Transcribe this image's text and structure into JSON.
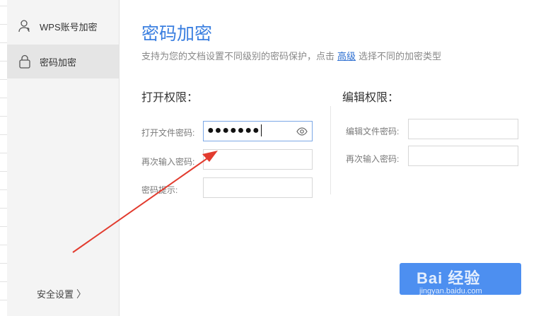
{
  "sidebar": {
    "items": [
      {
        "label": "WPS账号加密",
        "icon": "user-icon",
        "active": false
      },
      {
        "label": "密码加密",
        "icon": "lock-icon",
        "active": true
      }
    ],
    "security_settings": "安全设置"
  },
  "main": {
    "title": "密码加密",
    "description_prefix": "支持为您的文档设置不同级别的密码保护，点击",
    "description_link": "高级",
    "description_suffix": "选择不同的加密类型",
    "open_permission": {
      "section_title": "打开权限：",
      "password_label": "打开文件密码:",
      "password_value": "●●●●●●●",
      "confirm_label": "再次输入密码:",
      "confirm_value": "",
      "hint_label": "密码提示:",
      "hint_value": ""
    },
    "edit_permission": {
      "section_title": "编辑权限：",
      "password_label": "编辑文件密码:",
      "password_value": "",
      "confirm_label": "再次输入密码:",
      "confirm_value": ""
    }
  },
  "watermark": {
    "text": "Bai 经验",
    "sub": "jingyan.baidu.com"
  },
  "colors": {
    "accent": "#3b7fe0",
    "button": "#4d8ff0",
    "arrow": "#e23b2e"
  }
}
